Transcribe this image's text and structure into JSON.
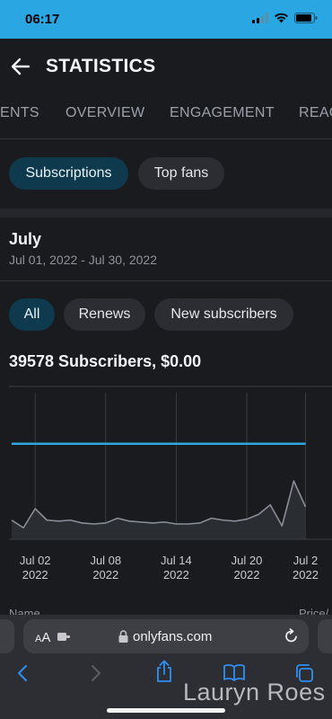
{
  "status_bar": {
    "time": "06:17",
    "battery_icon": "battery-icon",
    "wifi_icon": "wifi-icon",
    "signal_icon": "signal-icon"
  },
  "header": {
    "title": "STATISTICS",
    "back_icon": "arrow-left-icon"
  },
  "tabs": [
    {
      "label": "ENTS"
    },
    {
      "label": "OVERVIEW"
    },
    {
      "label": "ENGAGEMENT"
    },
    {
      "label": "REAC"
    }
  ],
  "segments": [
    {
      "label": "Subscriptions",
      "active": true
    },
    {
      "label": "Top fans",
      "active": false
    }
  ],
  "period": {
    "month": "July",
    "range": "Jul 01, 2022 - Jul 30, 2022"
  },
  "filters": [
    {
      "label": "All",
      "active": true
    },
    {
      "label": "Renews",
      "active": false
    },
    {
      "label": "New subscribers",
      "active": false
    }
  ],
  "summary": "39578 Subscribers, $0.00",
  "chart_data": {
    "type": "line",
    "x": [
      "Jun 30",
      "Jul 01",
      "Jul 02",
      "Jul 03",
      "Jul 04",
      "Jul 05",
      "Jul 06",
      "Jul 07",
      "Jul 08",
      "Jul 09",
      "Jul 10",
      "Jul 11",
      "Jul 12",
      "Jul 13",
      "Jul 14",
      "Jul 15",
      "Jul 16",
      "Jul 17",
      "Jul 18",
      "Jul 19",
      "Jul 20",
      "Jul 21",
      "Jul 22",
      "Jul 23",
      "Jul 24",
      "Jul 25"
    ],
    "tick_labels": [
      {
        "line1": "Jul 02",
        "line2": "2022",
        "x_index": 2
      },
      {
        "line1": "Jul 08",
        "line2": "2022",
        "x_index": 8
      },
      {
        "line1": "Jul 14",
        "line2": "2022",
        "x_index": 14
      },
      {
        "line1": "Jul 20",
        "line2": "2022",
        "x_index": 20
      },
      {
        "line1": "Jul 2",
        "line2": "2022",
        "x_index": 25
      }
    ],
    "series": [
      {
        "color": "#2ea6e0",
        "values": [
          100,
          100,
          100,
          100,
          100,
          100,
          100,
          100,
          100,
          100,
          100,
          100,
          100,
          100,
          100,
          100,
          100,
          100,
          100,
          100,
          100,
          100,
          100,
          100,
          100,
          100
        ]
      },
      {
        "color": "#8a8e96",
        "values": [
          20,
          12,
          32,
          20,
          19,
          20,
          17,
          16,
          17,
          22,
          19,
          18,
          17,
          18,
          16,
          16,
          17,
          22,
          20,
          19,
          21,
          26,
          36,
          14,
          61,
          34
        ]
      }
    ],
    "ylim": [
      0,
      160
    ],
    "grid": true
  },
  "table": {
    "col_name": "Name",
    "col_price": "Price/"
  },
  "browser": {
    "text_size_label": "AA",
    "url": "onlyfans.com",
    "reload_icon": "reload-icon",
    "toolbar_icons": [
      "back-icon",
      "forward-icon",
      "share-icon",
      "bookmarks-icon",
      "tabs-icon"
    ]
  },
  "watermark": "Lauryn Roes"
}
